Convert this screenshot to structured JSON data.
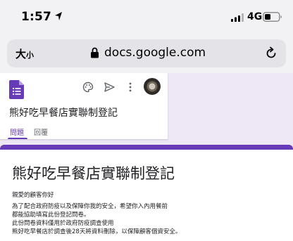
{
  "status_bar": {
    "time": "1:57",
    "network": "4G",
    "location_icon": "location-arrow-icon",
    "signal_icon": "cellular-signal-icon",
    "battery_icon": "battery-icon"
  },
  "browser": {
    "text_size_big": "大",
    "text_size_small": "小",
    "url": "docs.google.com",
    "lock_icon": "lock-icon",
    "reload_icon": "reload-icon"
  },
  "form_editor": {
    "form_name": "熊好吃早餐店實聯制登記",
    "tabs": [
      {
        "label": "問題",
        "active": true
      },
      {
        "label": "回覆",
        "active": false
      }
    ],
    "toolbar_icons": [
      "palette-icon",
      "send-icon",
      "more-vert-icon"
    ],
    "accent_color": "#673ab7"
  },
  "form_card": {
    "title": "熊好吃早餐店實聯制登記",
    "greeting": "親愛的顧客你好",
    "lines": [
      "為了配合政府防疫以及保障你我的安全，希望你入內用餐前",
      "都能協助填寫此份登記問卷。",
      "此份問卷資料僅用於政府防疫調查使用",
      "熊好吃早餐店於調查後28天將資料刪除，以保障顧客個資安全。"
    ]
  }
}
